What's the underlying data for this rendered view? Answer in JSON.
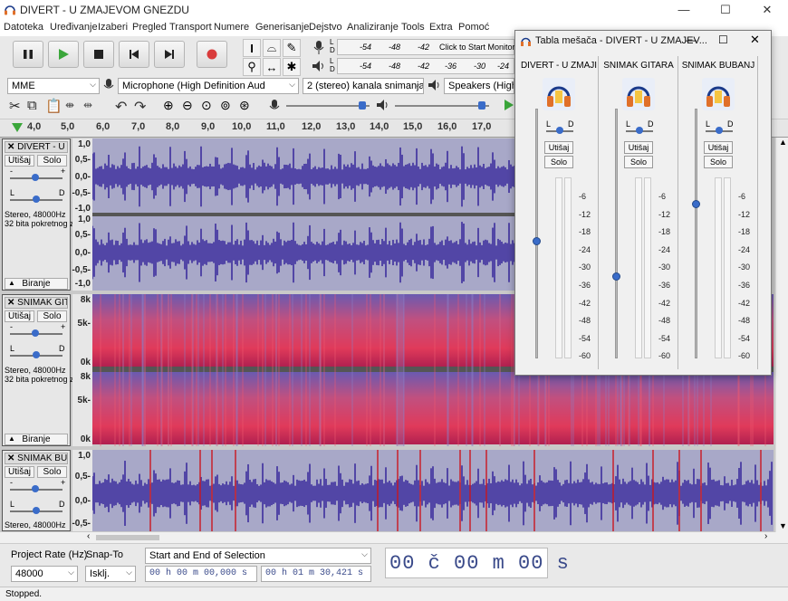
{
  "window": {
    "title": "DIVERT - U ZMAJEVOM GNEZDU",
    "minimize": "—",
    "maximize": "☐",
    "close": "✕"
  },
  "menu": [
    "Datoteka",
    "Uređivanje",
    "Izaberi",
    "Pregled",
    "Transport",
    "Numere",
    "Generisanje",
    "Dejstvo",
    "Analiziranje",
    "Tools",
    "Extra",
    "Pomoć"
  ],
  "meter": {
    "record_ticks": [
      "-54",
      "-48",
      "-42",
      "Click to Start Monitoring"
    ],
    "play_ticks": [
      "-54",
      "-48",
      "-42",
      "-36",
      "-30",
      "-24"
    ],
    "channel_L": "L",
    "channel_D": "D"
  },
  "devices": {
    "host": "MME",
    "mic": "Microphone (High Definition Aud",
    "channels": "2 (stereo) kanala snimanja",
    "speakers": "Speakers (High De"
  },
  "ruler": {
    "ticks": [
      "4,0",
      "5,0",
      "6,0",
      "7,0",
      "8,0",
      "9,0",
      "10,0",
      "11,0",
      "12,0",
      "13,0",
      "14,0",
      "15,0",
      "16,0",
      "17,0"
    ]
  },
  "tracks": [
    {
      "name": "DIVERT - U Z",
      "mute": "Utišaj",
      "solo": "Solo",
      "gain_minus": "-",
      "gain_plus": "+",
      "pan_L": "L",
      "pan_D": "D",
      "info1": "Stereo, 48000Hz",
      "info2": "32 bita pokretnog zareza",
      "select": "Biranje",
      "scale_top": [
        "1,0",
        "0,5-",
        "0,0-",
        "-0,5-",
        "-1,0"
      ],
      "scale_bot": [
        "1,0",
        "0,5-",
        "0,0-",
        "-0,5-",
        "-1,0"
      ]
    },
    {
      "name": "SNIMAK GIT",
      "mute": "Utišaj",
      "solo": "Solo",
      "gain_minus": "-",
      "gain_plus": "+",
      "pan_L": "L",
      "pan_D": "D",
      "info1": "Stereo, 48000Hz",
      "info2": "32 bita pokretnog zareza",
      "select": "Biranje",
      "scale_top": [
        "8k",
        "5k-",
        "0k"
      ],
      "scale_bot": [
        "8k",
        "5k-",
        "0k"
      ]
    },
    {
      "name": "SNIMAK BUB",
      "mute": "Utišaj",
      "solo": "Solo",
      "gain_minus": "-",
      "gain_plus": "+",
      "pan_L": "L",
      "pan_D": "D",
      "info1": "Stereo, 48000Hz",
      "scale_top": [
        "1,0",
        "0,5-",
        "0,0-",
        "-0,5-"
      ]
    }
  ],
  "mixer": {
    "title": "Tabla mešača - DIVERT - U ZMAJEV...",
    "strips": [
      {
        "name": "DIVERT - U ZMAJI",
        "mute": "Utišaj",
        "solo": "Solo",
        "L": "L",
        "D": "D",
        "fader_level": 0.47
      },
      {
        "name": "SNIMAK GITARA",
        "mute": "Utišaj",
        "solo": "Solo",
        "L": "L",
        "D": "D",
        "fader_level": 0.33
      },
      {
        "name": "SNIMAK BUBANJ",
        "mute": "Utišaj",
        "solo": "Solo",
        "L": "L",
        "D": "D",
        "fader_level": 0.62
      }
    ],
    "db_ticks": [
      "-6",
      "-12",
      "-18",
      "-24",
      "-30",
      "-36",
      "-42",
      "-48",
      "-54",
      "-60"
    ]
  },
  "selection": {
    "project_rate_label": "Project Rate (Hz)",
    "project_rate": "48000",
    "snap_label": "Snap-To",
    "snap": "Isklj.",
    "mode": "Start and End of Selection",
    "start": "00 h 00 m 00,000 s",
    "end": "00 h 01 m 30,421 s",
    "audio_position": "00 č 00 m 00 s"
  },
  "status": "Stopped.",
  "colors": {
    "waveform": "#3d2e9e",
    "accent_record": "#d93c3c",
    "play": "#3aa63a"
  }
}
